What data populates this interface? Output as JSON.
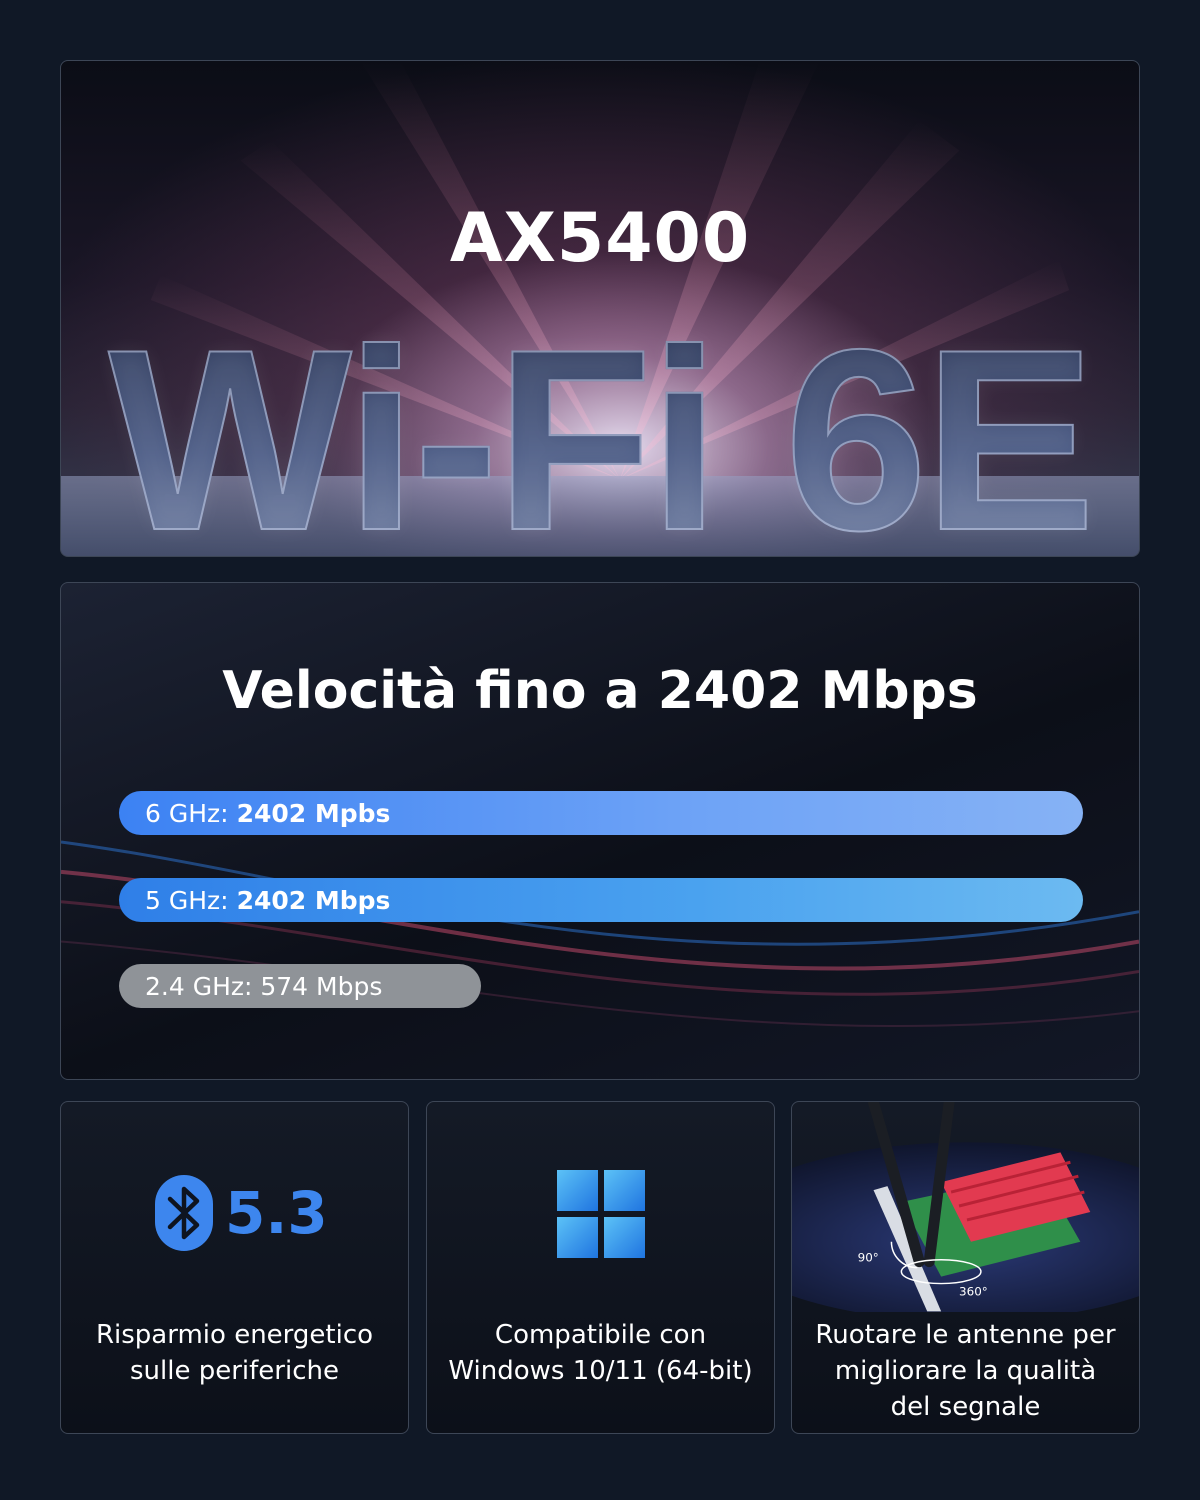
{
  "hero": {
    "model": "AX5400",
    "standard": "Wi-Fi 6E"
  },
  "speed": {
    "title": "Velocità fino a 2402 Mbps",
    "bars": [
      {
        "band": "6 GHz:",
        "value": "2402 Mpbs",
        "fraction": 1.0,
        "color": "#3c82f3"
      },
      {
        "band": "5 GHz:",
        "value": "2402 Mbps",
        "fraction": 1.0,
        "color": "#2f7fe8"
      },
      {
        "band": "2.4 GHz: 574 Mbps",
        "value": "",
        "fraction": 0.376,
        "color": "#8f9398"
      }
    ]
  },
  "features": {
    "bluetooth": {
      "icon": "bluetooth-icon",
      "version": "5.3",
      "line1": "Risparmio energetico",
      "line2": "sulle periferiche"
    },
    "windows": {
      "icon": "windows-icon",
      "line1": "Compatibile con",
      "line2": "Windows 10/11 (64-bit)"
    },
    "antenna": {
      "angle_a": "90°",
      "angle_b": "360°",
      "line1": "Ruotare le antenne per",
      "line2": "migliorare la qualità",
      "line3": "del segnale"
    }
  }
}
